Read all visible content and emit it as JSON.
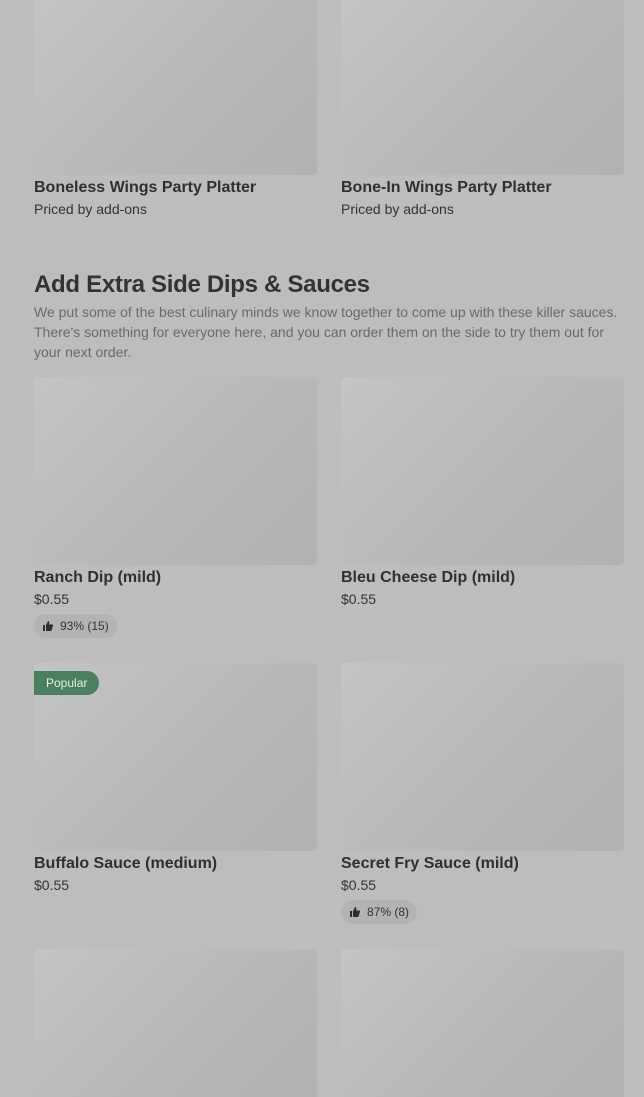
{
  "top_items": [
    {
      "title": "Boneless Wings Party Platter",
      "price": "Priced by add-ons"
    },
    {
      "title": "Bone-In Wings Party Platter",
      "price": "Priced by add-ons"
    }
  ],
  "section": {
    "title": "Add Extra Side Dips & Sauces",
    "description": "We put some of the best culinary minds we know together to come up with these killer sauces. There's something for everyone here, and you can order them on the side to try them out for your next order."
  },
  "items": [
    {
      "title": "Ranch Dip (mild)",
      "price": "$0.55",
      "rating": "93% (15)"
    },
    {
      "title": "Bleu Cheese Dip (mild)",
      "price": "$0.55"
    },
    {
      "title": "Buffalo Sauce (medium)",
      "price": "$0.55",
      "badge": "Popular"
    },
    {
      "title": "Secret Fry Sauce (mild)",
      "price": "$0.55",
      "rating": "87% (8)"
    }
  ],
  "icons": {
    "rating": "thumbs-up-icon"
  }
}
